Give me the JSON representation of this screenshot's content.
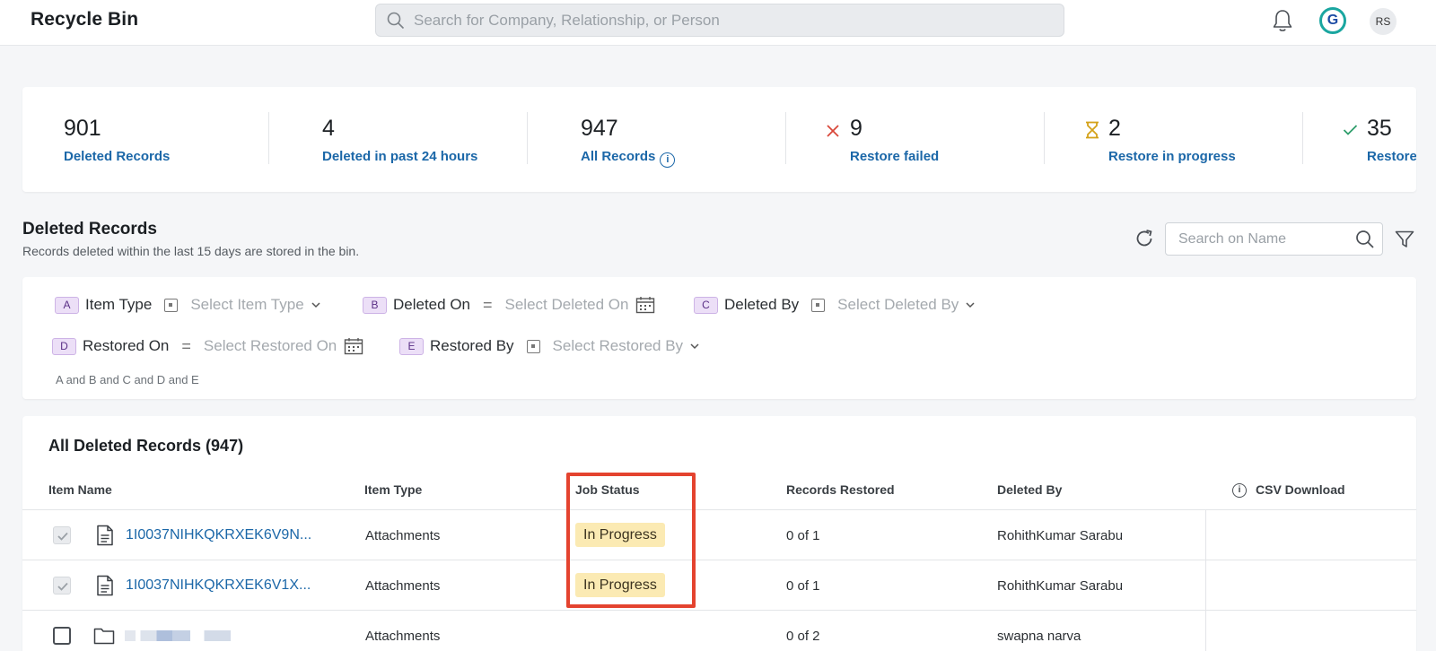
{
  "header": {
    "title": "Recycle Bin",
    "search_placeholder": "Search for Company, Relationship, or Person",
    "avatar_initials": "RS",
    "logo_letter": "G"
  },
  "stats": [
    {
      "value": "901",
      "label": "Deleted Records"
    },
    {
      "value": "4",
      "label": "Deleted in past 24 hours"
    },
    {
      "value": "947",
      "label": "All Records"
    },
    {
      "value": "9",
      "label": "Restore failed",
      "icon": "x-icon"
    },
    {
      "value": "2",
      "label": "Restore in progress",
      "icon": "hourglass-icon"
    },
    {
      "value": "35",
      "label": "Restore c",
      "icon": "check-icon"
    }
  ],
  "section": {
    "title": "Deleted Records",
    "subtitle": "Records deleted within the last 15 days are stored in the bin.",
    "name_search_placeholder": "Search on Name"
  },
  "filters": [
    {
      "badge": "A",
      "name": "Item Type",
      "placeholder": "Select Item Type"
    },
    {
      "badge": "B",
      "name": "Deleted On",
      "operator": "=",
      "placeholder": "Select Deleted On"
    },
    {
      "badge": "C",
      "name": "Deleted By",
      "placeholder": "Select Deleted By"
    },
    {
      "badge": "D",
      "name": "Restored On",
      "operator": "=",
      "placeholder": "Select Restored On"
    },
    {
      "badge": "E",
      "name": "Restored By",
      "placeholder": "Select Restored By"
    }
  ],
  "filter_logic": "A and B and C and D and E",
  "table": {
    "title": "All Deleted Records (947)",
    "columns": [
      "Item Name",
      "Item Type",
      "Job Status",
      "Records Restored",
      "Deleted By",
      "CSV Download"
    ],
    "rows": [
      {
        "name": "1I0037NIHKQKRXEK6V9N...",
        "type": "Attachments",
        "status": "In Progress",
        "restored": "0 of 1",
        "deleted_by": "RohithKumar Sarabu",
        "checked": true,
        "icon": "file-icon"
      },
      {
        "name": "1I0037NIHKQKRXEK6V1X...",
        "type": "Attachments",
        "status": "In Progress",
        "restored": "0 of 1",
        "deleted_by": "RohithKumar Sarabu",
        "checked": true,
        "icon": "file-icon"
      },
      {
        "name": "",
        "type": "Attachments",
        "status": "",
        "restored": "0 of 2",
        "deleted_by": "swapna narva",
        "checked": false,
        "icon": "folder-icon"
      }
    ]
  },
  "colors": {
    "accent_link": "#1b67a8",
    "status_pill": "#fbeab3",
    "highlight_box": "#e4432f",
    "badge_bg": "#ecdff7"
  }
}
